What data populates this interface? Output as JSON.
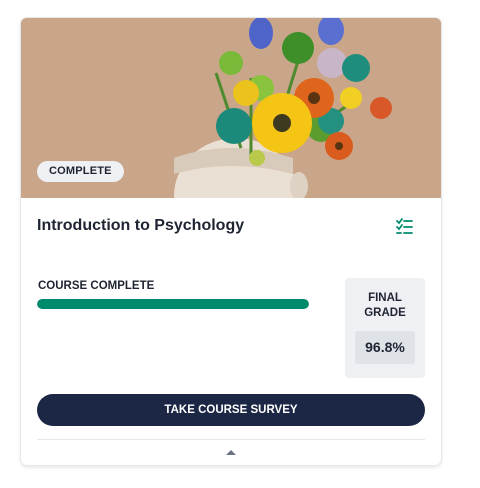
{
  "course": {
    "status_badge": "COMPLETE",
    "title": "Introduction to Psychology",
    "image_description": "head-sculpture-with-flowers"
  },
  "progress": {
    "label": "COURSE COMPLETE",
    "percent": 100,
    "color": "#008a6c"
  },
  "grade": {
    "label": "FINAL\nGRADE",
    "value": "96.8%"
  },
  "actions": {
    "survey_label": "TAKE COURSE SURVEY"
  },
  "icons": {
    "checklist": "checklist-icon",
    "collapse": "caret-up-icon"
  },
  "colors": {
    "primary": "#1b2744",
    "accent": "#008a6c",
    "hero_background": "#c9a589"
  }
}
